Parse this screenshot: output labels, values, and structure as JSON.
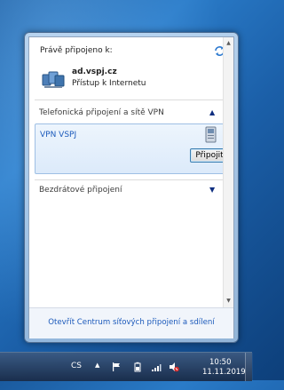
{
  "flyout": {
    "connected_label": "Právě připojeno k:",
    "network": {
      "name": "ad.vspj.cz",
      "status": "Přístup k Internetu"
    },
    "groups": [
      {
        "label": "Telefonická připojení a sítě VPN",
        "expanded": true
      },
      {
        "label": "Bezdrátové připojení",
        "expanded": false
      }
    ],
    "vpn": {
      "label": "VPN VSPJ",
      "connect_label": "Připojit"
    },
    "footer_link": "Otevřít Centrum síťových připojení a sdílení"
  },
  "taskbar": {
    "language": "CS",
    "time": "10:50",
    "date": "11.11.2019"
  },
  "colors": {
    "link": "#1c5abb",
    "accent": "#0e2e80",
    "desktop": "#1b5fa8"
  }
}
